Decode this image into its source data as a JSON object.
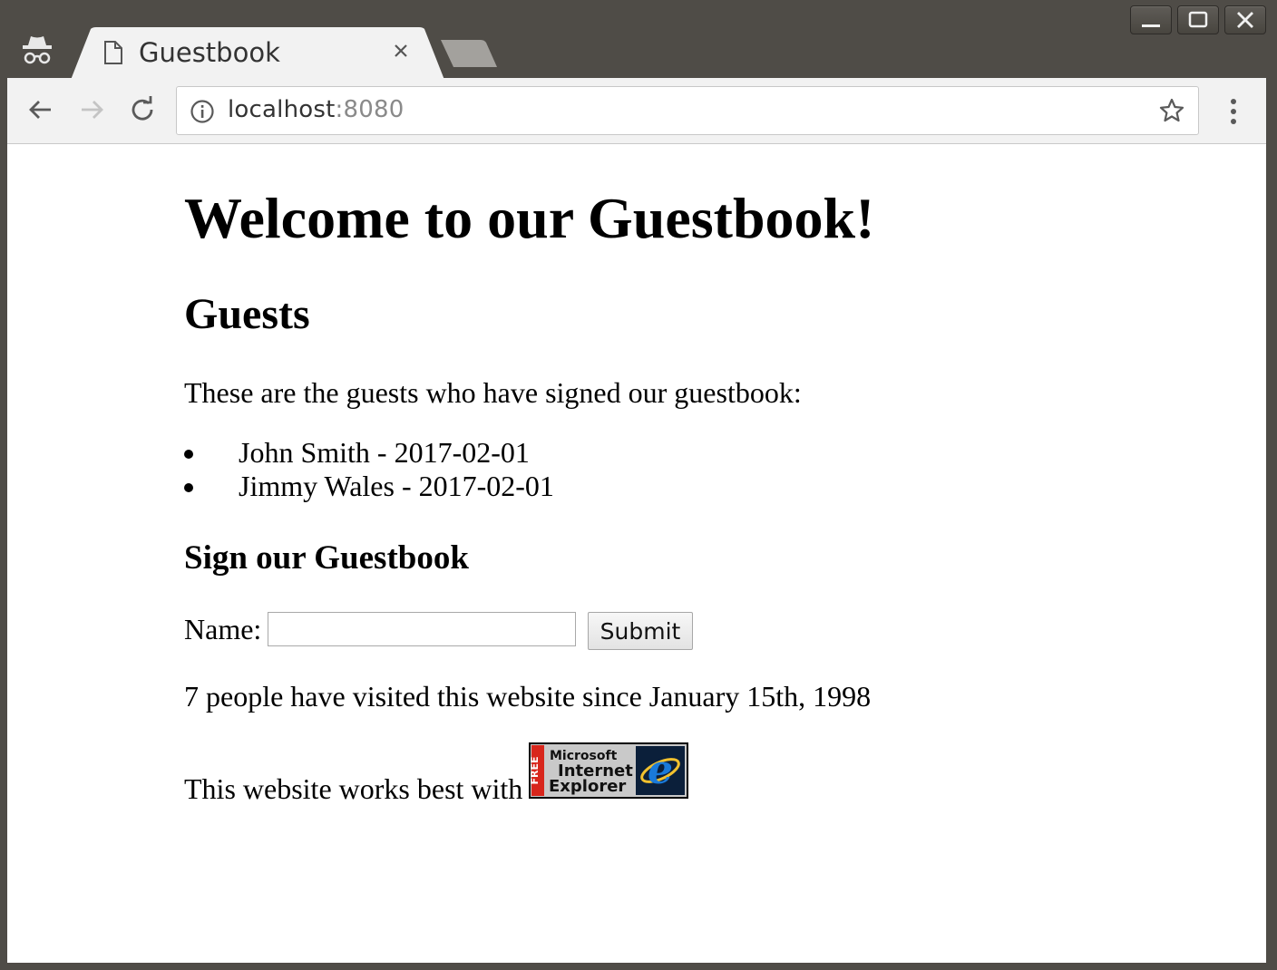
{
  "browser": {
    "tab": {
      "title": "Guestbook"
    },
    "address": {
      "host": "localhost",
      "port": ":8080"
    },
    "icons": {
      "incognito": "incognito-icon",
      "page": "document-icon",
      "close": "close-icon",
      "back": "back-arrow-icon",
      "forward": "forward-arrow-icon",
      "reload": "reload-icon",
      "info": "info-icon",
      "bookmark": "star-icon",
      "menu": "kebab-menu-icon"
    }
  },
  "page": {
    "heading": "Welcome to our Guestbook!",
    "guests_heading": "Guests",
    "guests_intro": "These are the guests who have signed our guestbook:",
    "guests": [
      "John Smith - 2017-02-01",
      "Jimmy Wales - 2017-02-01"
    ],
    "sign_heading": "Sign our Guestbook",
    "form": {
      "name_label": "Name:",
      "name_value": "",
      "submit_label": "Submit"
    },
    "visitor_counter": "7 people have visited this website since January 15th, 1998",
    "works_best": "This website works best with",
    "badge": {
      "free": "FREE",
      "line1": "Microsoft",
      "line2": "Internet",
      "line3": "Explorer"
    }
  },
  "colors": {
    "window_frame": "#4f4c47",
    "toolbar": "#f2f2f2",
    "content_bg": "#ffffff",
    "badge_red": "#d8261c",
    "badge_blue": "#1a5fb4"
  }
}
